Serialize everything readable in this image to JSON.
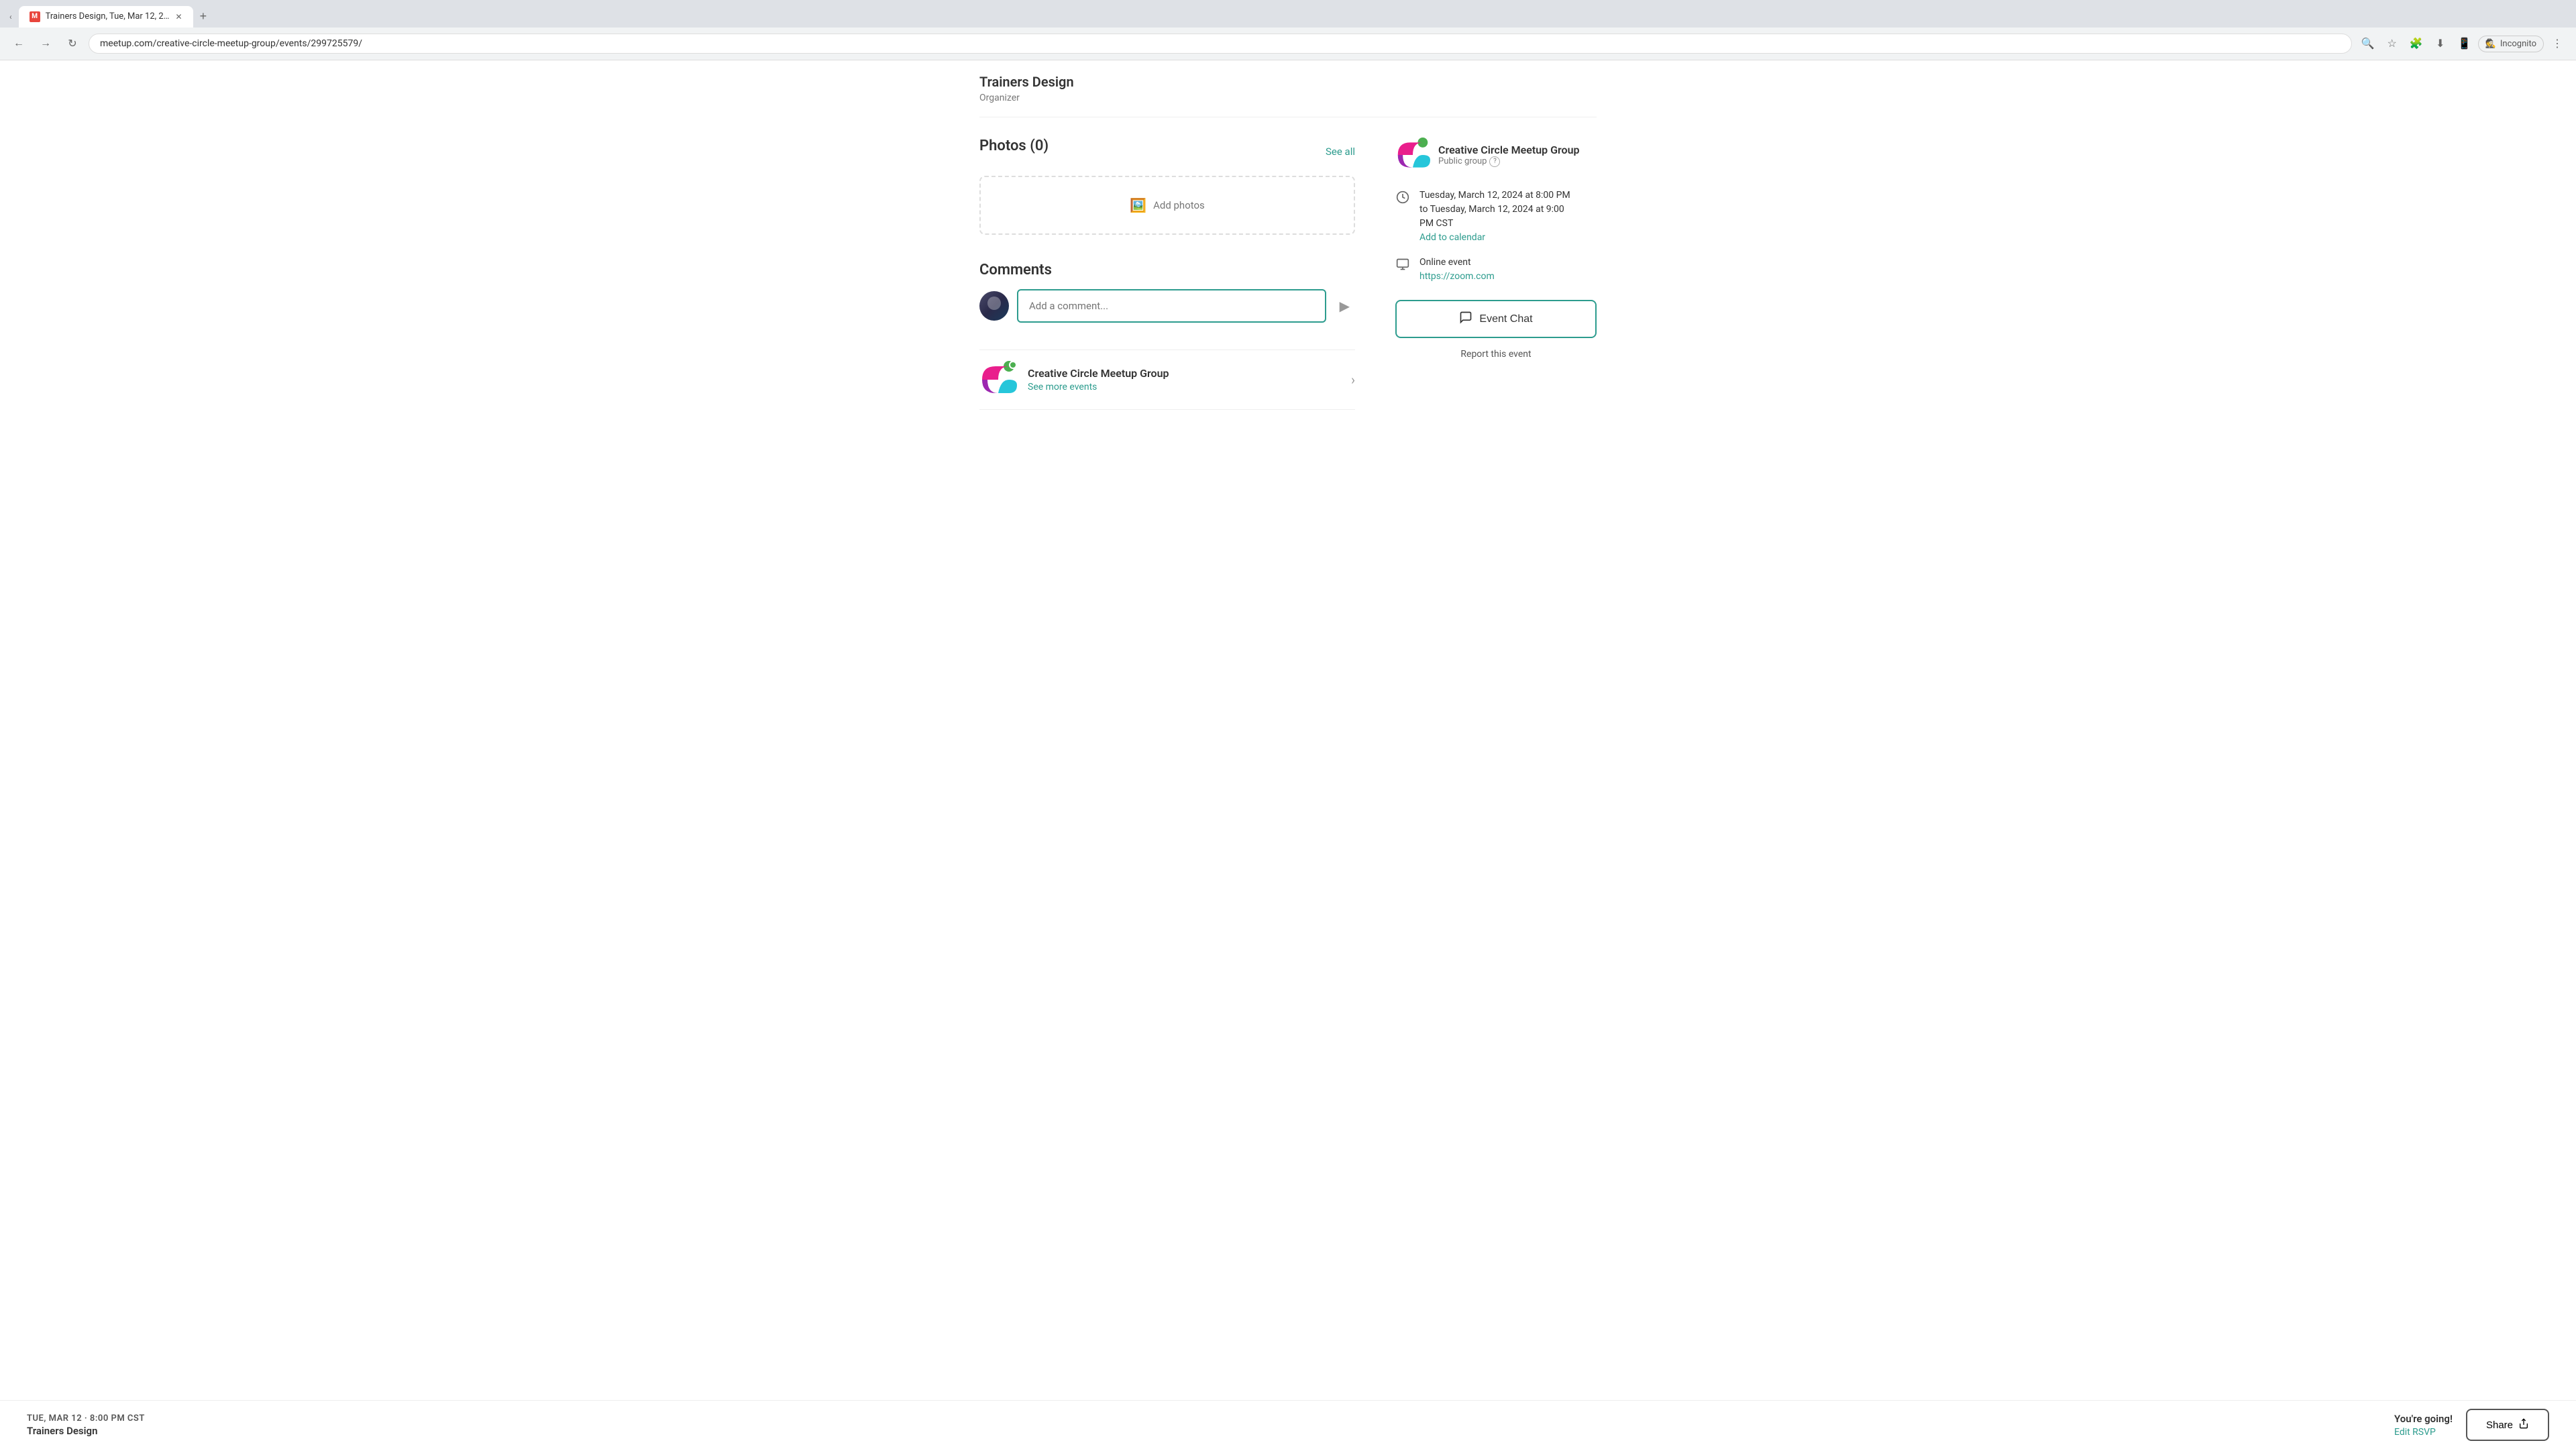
{
  "browser": {
    "tab_title": "Trainers Design, Tue, Mar 12, 2...",
    "favicon_letter": "M",
    "url": "meetup.com/creative-circle-meetup-group/events/299725579/",
    "incognito_label": "Incognito"
  },
  "organizer": {
    "name": "Trainers Design",
    "role": "Organizer"
  },
  "photos_section": {
    "title": "Photos (0)",
    "see_all": "See all",
    "add_photos_label": "Add photos"
  },
  "comments_section": {
    "title": "Comments",
    "placeholder": "Add a comment..."
  },
  "group_card": {
    "name": "Creative Circle Meetup Group",
    "see_more": "See more events"
  },
  "right_panel": {
    "group_name": "Creative Circle Meetup Group",
    "public_group": "Public group",
    "date_time": "Tuesday, March 12, 2024 at 8:00 PM\nto Tuesday, March 12, 2024 at 9:00\nPM CST",
    "add_to_calendar": "Add to calendar",
    "event_type": "Online event",
    "event_url": "https://zoom.com",
    "event_chat_label": "Event Chat",
    "report_label": "Report this event"
  },
  "footer": {
    "date": "TUE, MAR 12 · 8:00 PM CST",
    "event_name": "Trainers Design",
    "going_label": "You're going!",
    "edit_rsvp": "Edit RSVP",
    "share_label": "Share"
  }
}
